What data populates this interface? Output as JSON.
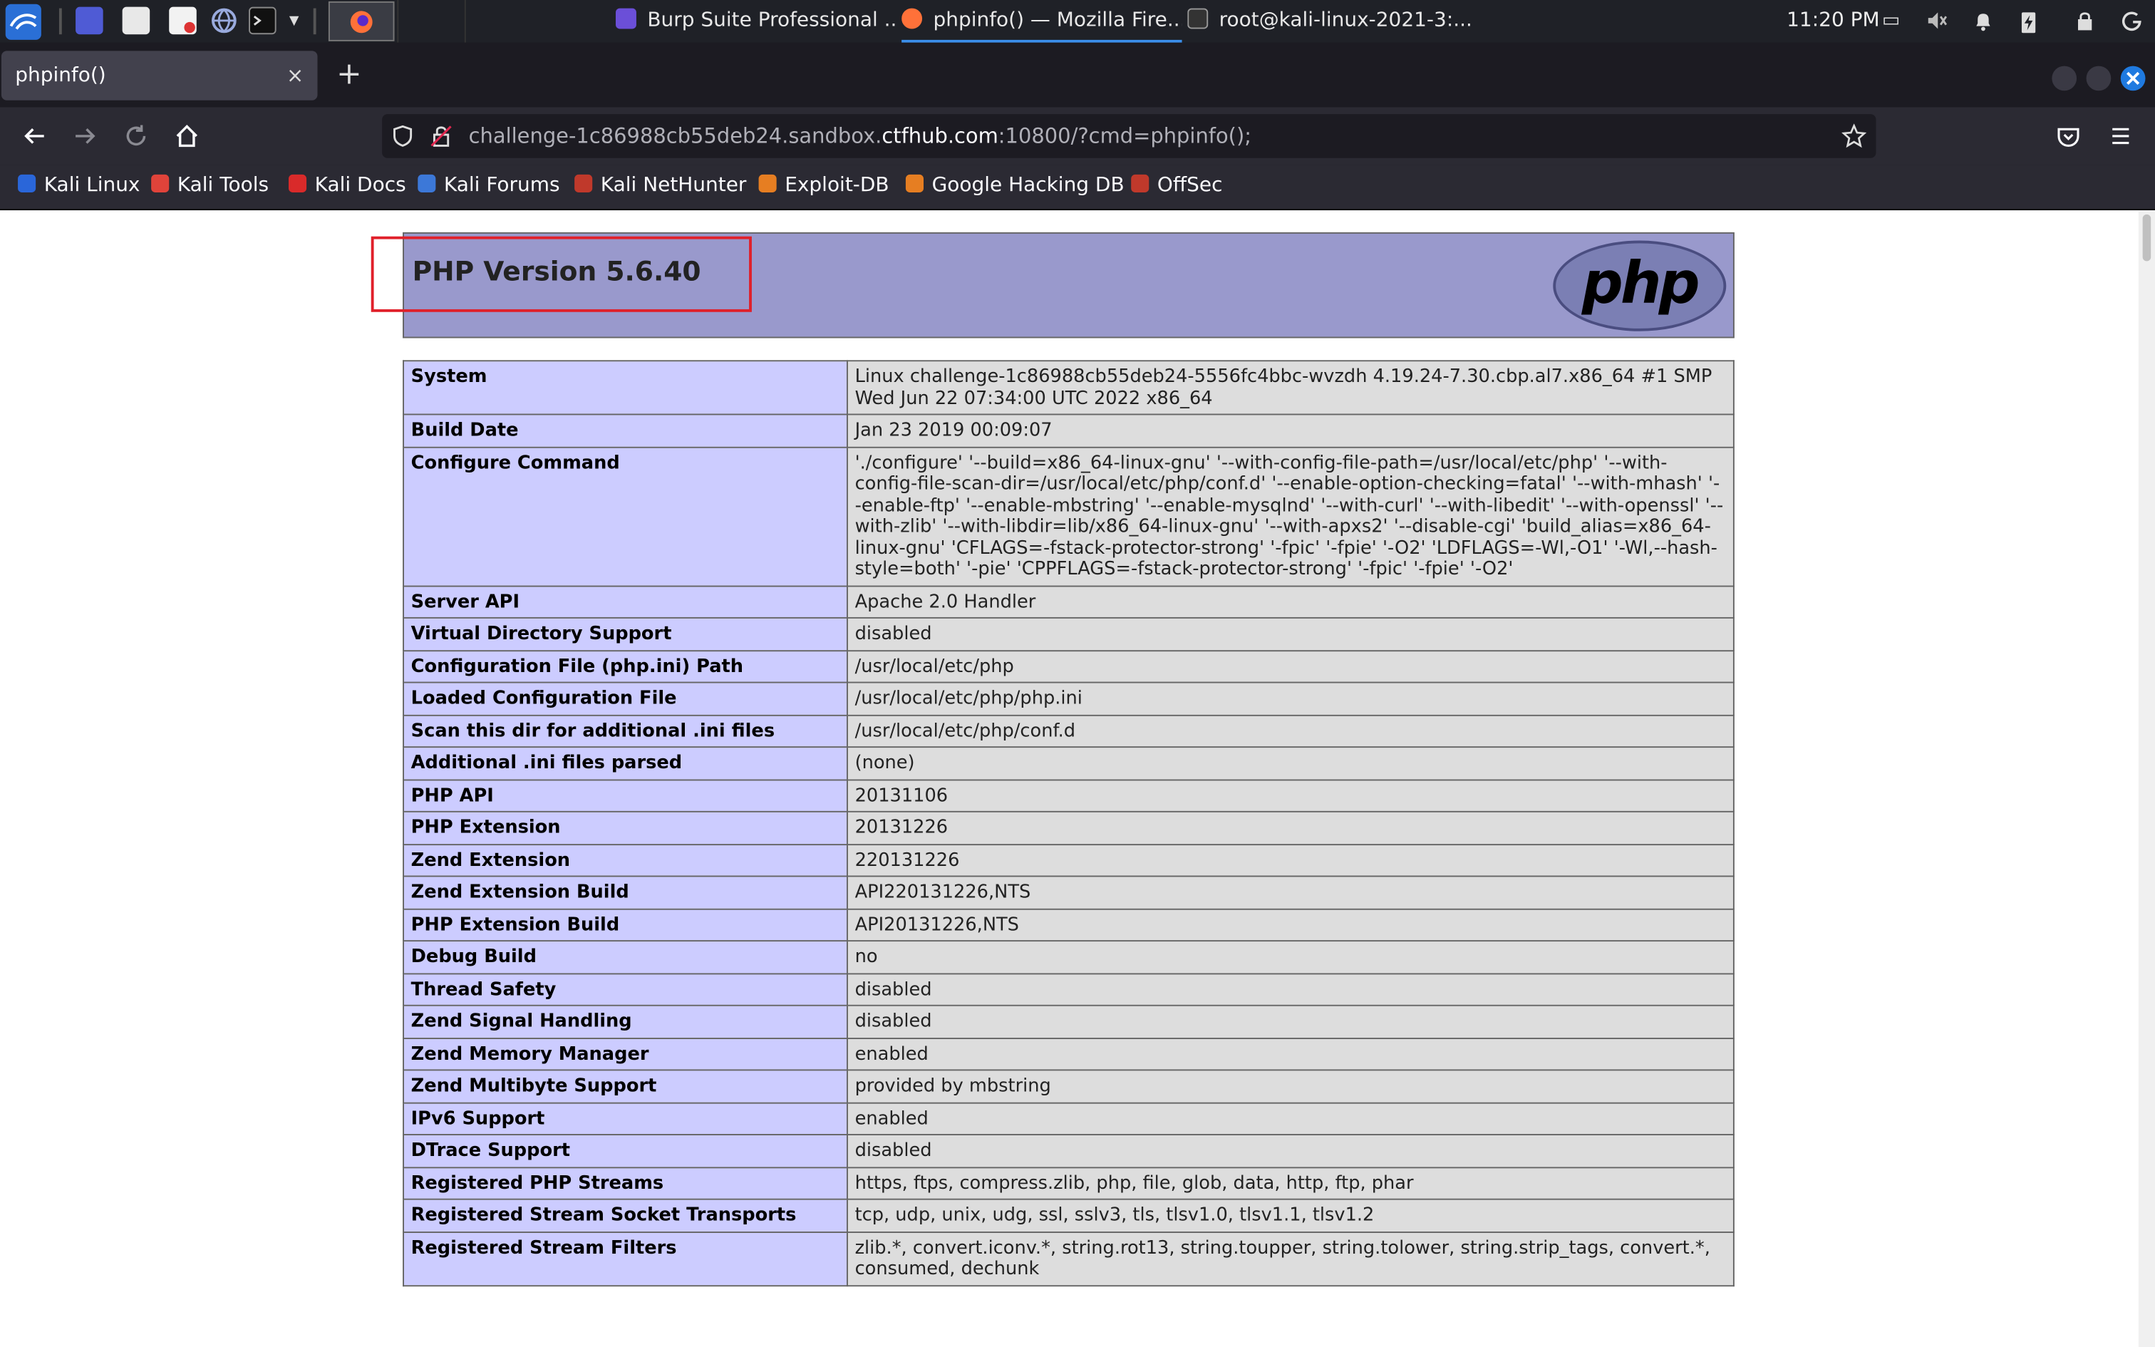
{
  "taskbar": {
    "tasks": [
      {
        "label": "Burp Suite Professional ...",
        "color": "#6b4fd8"
      },
      {
        "label": "phpinfo() — Mozilla Fire...",
        "color": "#ff7139"
      },
      {
        "label": "root@kali-linux-2021-3:...",
        "color": "#333333"
      }
    ],
    "clock": "11:20 PM"
  },
  "browser": {
    "tab_title": "phpinfo()",
    "tab_close": "×",
    "new_tab": "+",
    "url_prefix": "challenge-1c86988cb55deb24.sandbox.",
    "url_domain": "ctfhub.com",
    "url_suffix": ":10800/?cmd=phpinfo();",
    "bookmarks": [
      {
        "label": "Kali Linux",
        "color": "#2a66d9"
      },
      {
        "label": "Kali Tools",
        "color": "#e0433a"
      },
      {
        "label": "Kali Docs",
        "color": "#d92a2a"
      },
      {
        "label": "Kali Forums",
        "color": "#3c78d8"
      },
      {
        "label": "Kali NetHunter",
        "color": "#c0392b"
      },
      {
        "label": "Exploit-DB",
        "color": "#e67e22"
      },
      {
        "label": "Google Hacking DB",
        "color": "#e67e22"
      },
      {
        "label": "OffSec",
        "color": "#c0392b"
      }
    ]
  },
  "phpinfo": {
    "title": "PHP Version 5.6.40",
    "logo_text": "php",
    "rows": [
      {
        "key": "System",
        "value": "Linux challenge-1c86988cb55deb24-5556fc4bbc-wvzdh 4.19.24-7.30.cbp.al7.x86_64 #1 SMP Wed Jun 22 07:34:00 UTC 2022 x86_64"
      },
      {
        "key": "Build Date",
        "value": "Jan 23 2019 00:09:07"
      },
      {
        "key": "Configure Command",
        "value": "'./configure' '--build=x86_64-linux-gnu' '--with-config-file-path=/usr/local/etc/php' '--with-config-file-scan-dir=/usr/local/etc/php/conf.d' '--enable-option-checking=fatal' '--with-mhash' '--enable-ftp' '--enable-mbstring' '--enable-mysqlnd' '--with-curl' '--with-libedit' '--with-openssl' '--with-zlib' '--with-libdir=lib/x86_64-linux-gnu' '--with-apxs2' '--disable-cgi' 'build_alias=x86_64-linux-gnu' 'CFLAGS=-fstack-protector-strong' '-fpic' '-fpie' '-O2' 'LDFLAGS=-Wl,-O1' '-Wl,--hash-style=both' '-pie' 'CPPFLAGS=-fstack-protector-strong' '-fpic' '-fpie' '-O2'"
      },
      {
        "key": "Server API",
        "value": "Apache 2.0 Handler"
      },
      {
        "key": "Virtual Directory Support",
        "value": "disabled"
      },
      {
        "key": "Configuration File (php.ini) Path",
        "value": "/usr/local/etc/php"
      },
      {
        "key": "Loaded Configuration File",
        "value": "/usr/local/etc/php/php.ini"
      },
      {
        "key": "Scan this dir for additional .ini files",
        "value": "/usr/local/etc/php/conf.d"
      },
      {
        "key": "Additional .ini files parsed",
        "value": "(none)"
      },
      {
        "key": "PHP API",
        "value": "20131106"
      },
      {
        "key": "PHP Extension",
        "value": "20131226"
      },
      {
        "key": "Zend Extension",
        "value": "220131226"
      },
      {
        "key": "Zend Extension Build",
        "value": "API220131226,NTS"
      },
      {
        "key": "PHP Extension Build",
        "value": "API20131226,NTS"
      },
      {
        "key": "Debug Build",
        "value": "no"
      },
      {
        "key": "Thread Safety",
        "value": "disabled"
      },
      {
        "key": "Zend Signal Handling",
        "value": "disabled"
      },
      {
        "key": "Zend Memory Manager",
        "value": "enabled"
      },
      {
        "key": "Zend Multibyte Support",
        "value": "provided by mbstring"
      },
      {
        "key": "IPv6 Support",
        "value": "enabled"
      },
      {
        "key": "DTrace Support",
        "value": "disabled"
      },
      {
        "key": "Registered PHP Streams",
        "value": "https, ftps, compress.zlib, php, file, glob, data, http, ftp, phar"
      },
      {
        "key": "Registered Stream Socket Transports",
        "value": "tcp, udp, unix, udg, ssl, sslv3, tls, tlsv1.0, tlsv1.1, tlsv1.2"
      },
      {
        "key": "Registered Stream Filters",
        "value": "zlib.*, convert.iconv.*, string.rot13, string.toupper, string.tolower, string.strip_tags, convert.*, consumed, dechunk"
      }
    ]
  },
  "colors": {
    "header_bg": "#9999cc",
    "key_bg": "#ccccff",
    "value_bg": "#dddddd",
    "highlight": "#e0202a",
    "accent": "#3b8eea"
  }
}
